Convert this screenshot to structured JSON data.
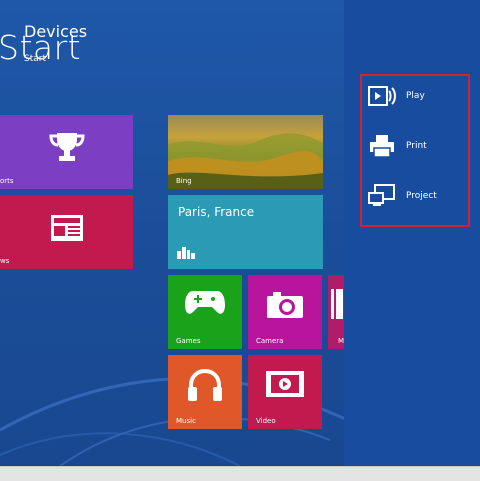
{
  "screen": {
    "title": "Start"
  },
  "tiles": {
    "sports": {
      "label": "orts",
      "color": "#7c3fc4"
    },
    "news": {
      "label": "ws",
      "color": "#c2194f"
    },
    "bing": {
      "label": "Bing"
    },
    "weather": {
      "city": "Paris, France",
      "color": "#2b9ab4"
    },
    "games": {
      "label": "Games",
      "color": "#1aa31a"
    },
    "camera": {
      "label": "Camera",
      "color": "#b8159c"
    },
    "maps": {
      "label": "M",
      "color": "#b01b6a"
    },
    "music": {
      "label": "Music",
      "color": "#e0582a"
    },
    "video": {
      "label": "Video",
      "color": "#c2194f"
    }
  },
  "charm": {
    "title": "Devices",
    "subtitle": "Start",
    "items": [
      {
        "label": "Play",
        "icon": "play-to-device-icon"
      },
      {
        "label": "Print",
        "icon": "printer-icon"
      },
      {
        "label": "Project",
        "icon": "projector-screen-icon"
      }
    ],
    "highlight_color": "#d0222f"
  }
}
